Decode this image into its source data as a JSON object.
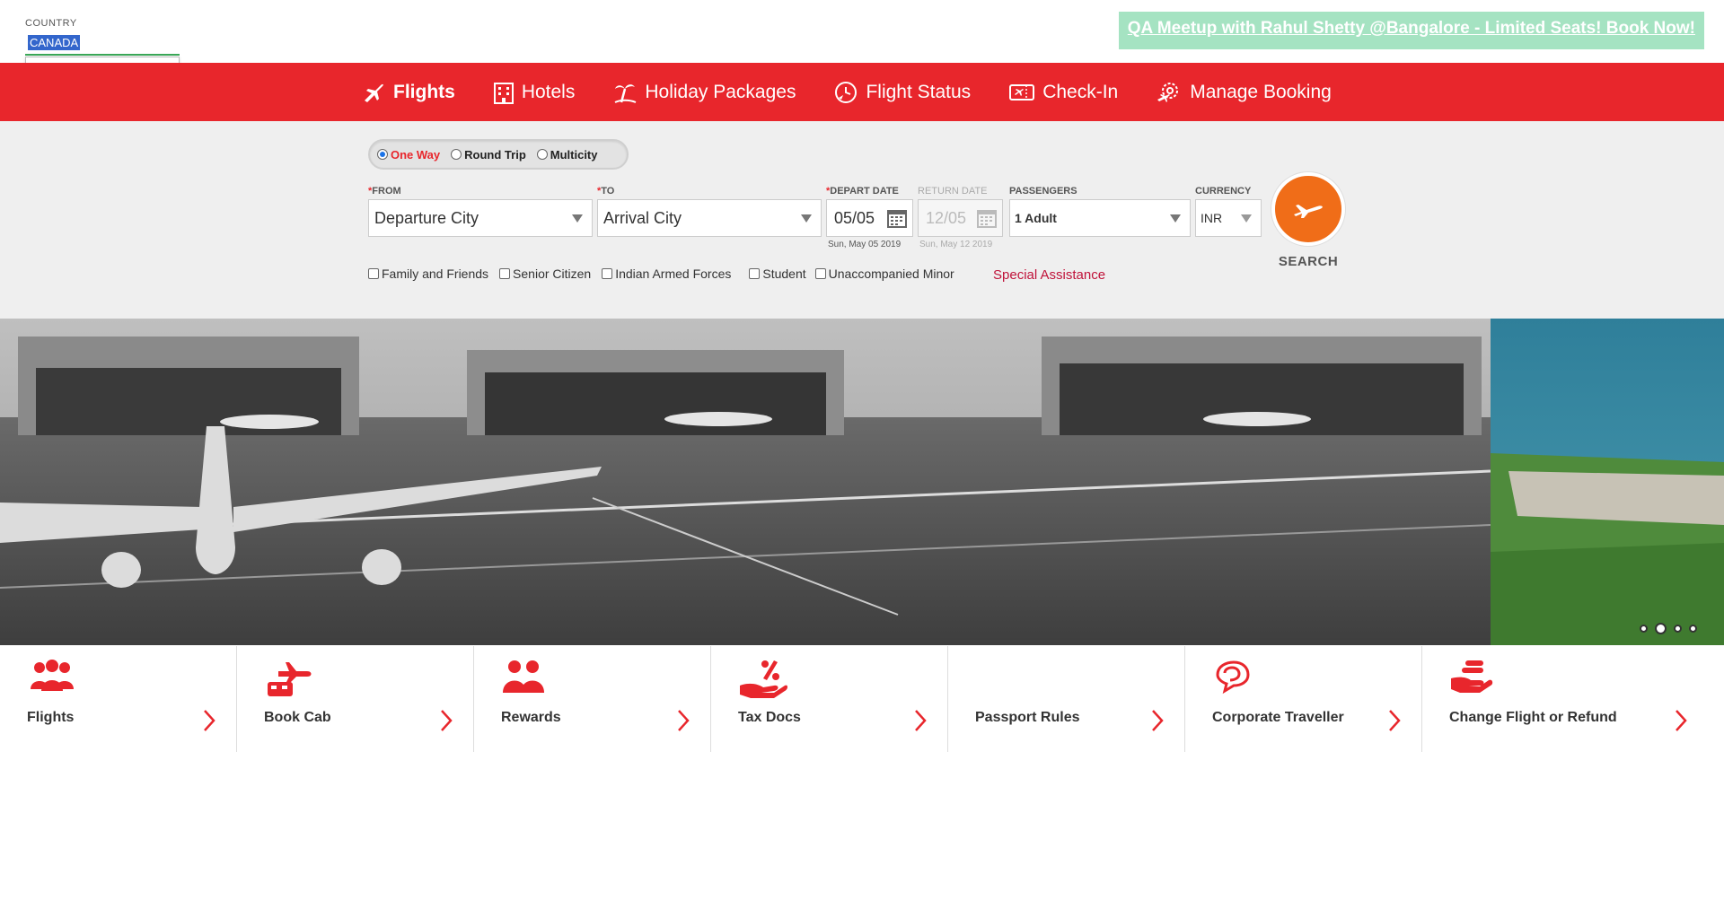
{
  "country": {
    "label": "COUNTRY",
    "input_value": "CANADA",
    "dropdown_option": "Canada"
  },
  "promo": {
    "text": "QA Meetup with Rahul Shetty @Bangalore - Limited Seats! Book Now!"
  },
  "nav": {
    "items": [
      {
        "label": "Flights",
        "icon": "plane-icon"
      },
      {
        "label": "Hotels",
        "icon": "hotel-icon"
      },
      {
        "label": "Holiday Packages",
        "icon": "palm-tree-icon"
      },
      {
        "label": "Flight Status",
        "icon": "clock-icon"
      },
      {
        "label": "Check-In",
        "icon": "ticket-icon"
      },
      {
        "label": "Manage Booking",
        "icon": "gear-plane-icon"
      }
    ],
    "active": "Flights"
  },
  "search": {
    "trip_types": [
      "One Way",
      "Round Trip",
      "Multicity"
    ],
    "selected_trip": "One Way",
    "from_label": "FROM",
    "from_value": "Departure City",
    "to_label": "TO",
    "to_value": "Arrival City",
    "depart_label": "DEPART DATE",
    "depart_value": "05/05",
    "depart_sub": "Sun, May 05 2019",
    "return_label": "RETURN DATE",
    "return_value": "12/05",
    "return_sub": "Sun, May 12 2019",
    "passengers_label": "PASSENGERS",
    "passengers_value": "1 Adult",
    "currency_label": "CURRENCY",
    "currency_value": "INR",
    "search_label": "SEARCH",
    "checkboxes": [
      "Family and Friends",
      "Senior Citizen",
      "Indian Armed Forces",
      "Student",
      "Unaccompanied Minor"
    ],
    "special_assistance": "Special Assistance"
  },
  "tiles": [
    {
      "label": "Flights",
      "icon": "people-group-icon"
    },
    {
      "label": "Book Cab",
      "icon": "cab-plane-icon"
    },
    {
      "label": "Rewards",
      "icon": "rewards-people-icon"
    },
    {
      "label": "Tax Docs",
      "icon": "percent-hand-icon"
    },
    {
      "label": "Passport Rules",
      "icon": ""
    },
    {
      "label": "Corporate Traveller",
      "icon": "chat-bubble-icon"
    },
    {
      "label": "Change Flight or Refund",
      "icon": "refund-hand-icon"
    }
  ],
  "colors": {
    "brand_red": "#e8262c",
    "search_orange": "#f06d18",
    "promo_green": "#a5e3c2"
  }
}
